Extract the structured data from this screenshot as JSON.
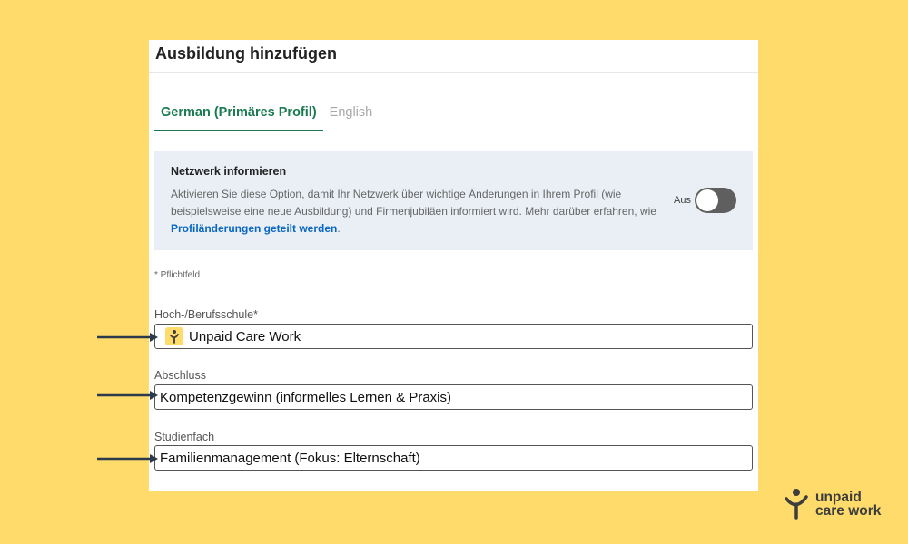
{
  "dialog": {
    "title": "Ausbildung hinzufügen",
    "tabs": [
      {
        "label": "German (Primäres Profil)",
        "active": true
      },
      {
        "label": "English",
        "active": false
      }
    ]
  },
  "notify": {
    "title": "Netzwerk informieren",
    "text": "Aktivieren Sie diese Option, damit Ihr Netzwerk über wichtige Änderungen in Ihrem Profil (wie beispielsweise eine neue Ausbildung) und Firmenjubiläen informiert wird. Mehr darüber erfahren, wie ",
    "link": "Profiländerungen geteilt werden",
    "link_suffix": ".",
    "toggle_label": "Aus",
    "toggle_on": false
  },
  "form": {
    "required_note": "* Pflichtfeld",
    "school": {
      "label": "Hoch-/Berufsschule*",
      "value": "Unpaid Care Work"
    },
    "degree": {
      "label": "Abschluss",
      "value": "Kompetenzgewinn (informelles Lernen & Praxis)"
    },
    "field": {
      "label": "Studienfach",
      "value": "Familienmanagement (Fokus: Elternschaft)"
    }
  },
  "brand": {
    "line1": "unpaid",
    "line2": "care work"
  },
  "colors": {
    "background": "#FEDB6B",
    "accent_green": "#1a7a50",
    "link_blue": "#0a66c2",
    "infobox": "#e9eff5"
  },
  "icons": [
    "arrow-right-icon",
    "school-logo-icon",
    "unpaid-care-work-logo-icon"
  ]
}
